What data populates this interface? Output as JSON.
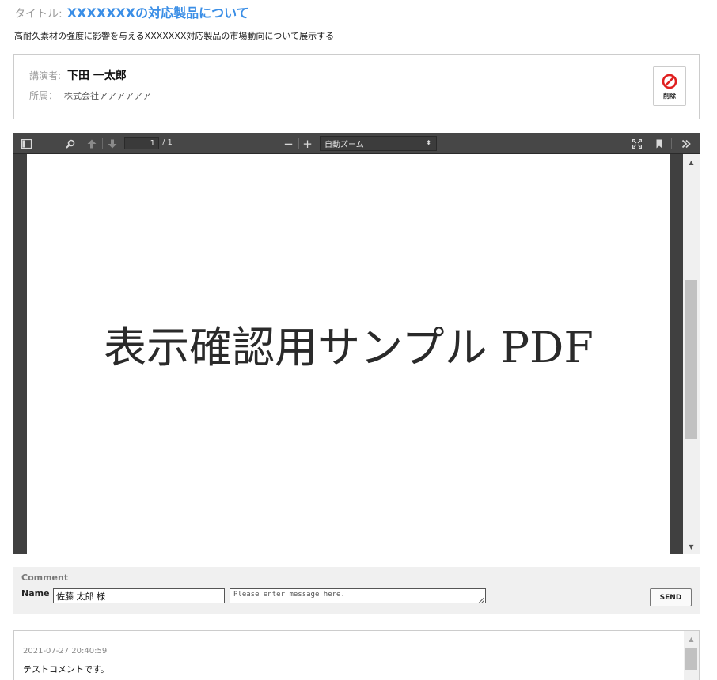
{
  "header": {
    "title_label": "タイトル:",
    "title": "XXXXXXXの対応製品について",
    "description": "高耐久素材の強度に影響を与えるXXXXXXX対応製品の市場動向について展示する"
  },
  "speaker": {
    "speaker_label": "講演者:",
    "speaker_name": "下田 一太郎",
    "affiliation_label": "所属：",
    "affiliation": "株式会社アアアアアア",
    "delete_label": "削除"
  },
  "pdf_viewer": {
    "toolbar": {
      "sidebar_icon": "sidebar-toggle-icon",
      "search_icon": "search-icon",
      "page_number": "1",
      "page_total": "/ 1",
      "zoom_minus": "−",
      "zoom_plus": "+",
      "zoom_value": "自動ズーム",
      "presentation_icon": "fullscreen-icon",
      "bookmark_icon": "bookmark-icon",
      "tools_icon": "double-chevron-right-icon"
    },
    "page_content": "表示確認用サンプル PDF"
  },
  "comment_form": {
    "title": "Comment",
    "name_label": "Name",
    "name_value": "佐藤 太郎 様",
    "message_placeholder": "Please enter message here.",
    "send_label": "SEND"
  },
  "comments": [
    {
      "timestamp": "2021-07-27 20:40:59",
      "text": "テストコメントです。"
    }
  ]
}
